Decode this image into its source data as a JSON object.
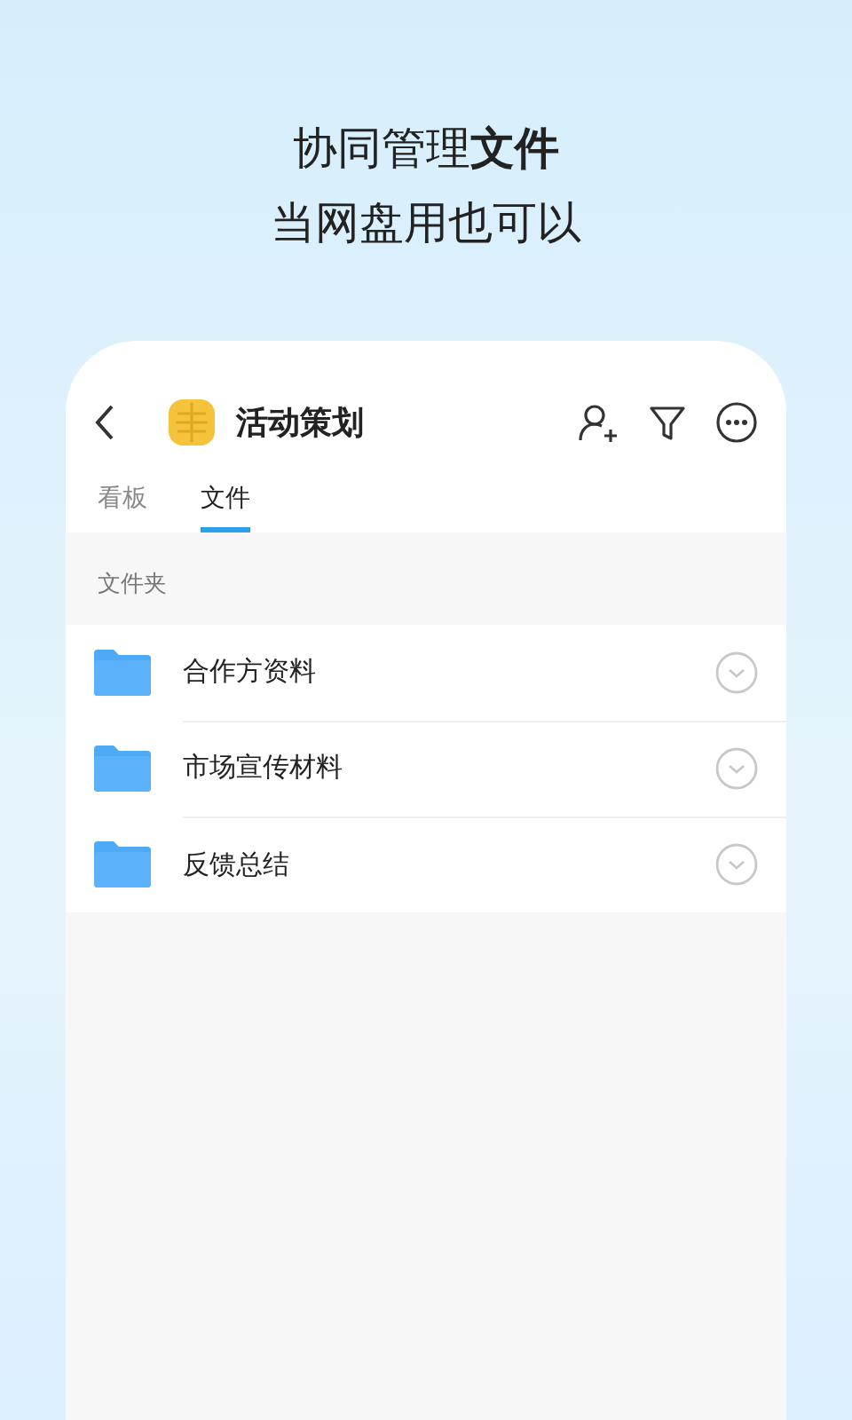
{
  "headline": {
    "line_1": "协同管理**文件**",
    "line_2": "当网盘用也可以"
  },
  "header": {
    "title": "活动策划"
  },
  "tabs": [
    {
      "label": "看板",
      "selected": false
    },
    {
      "label": "文件",
      "selected": true
    }
  ],
  "section": {
    "label": "文件夹"
  },
  "folders": [
    {
      "name": "合作方资料"
    },
    {
      "name": "市场宣传材料"
    },
    {
      "name": "反馈总结"
    }
  ]
}
